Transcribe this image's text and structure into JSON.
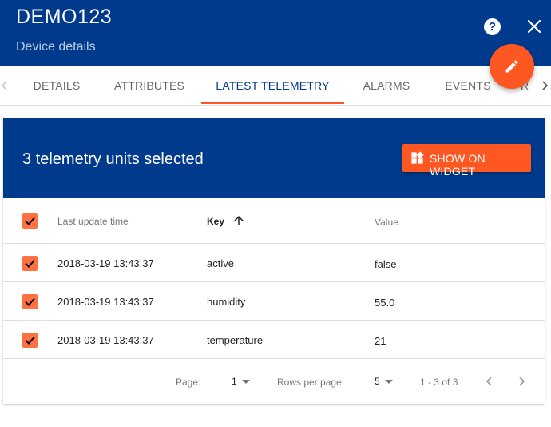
{
  "header": {
    "title": "DEMO123",
    "subtitle": "Device details",
    "help_label": "?"
  },
  "tabs": [
    {
      "label": "DETAILS"
    },
    {
      "label": "ATTRIBUTES"
    },
    {
      "label": "LATEST TELEMETRY",
      "active": true
    },
    {
      "label": "ALARMS"
    },
    {
      "label": "EVENTS"
    },
    {
      "label": "R"
    }
  ],
  "telemetry": {
    "selected_text": "3 telemetry units selected",
    "show_widget_label": "SHOW ON WIDGET",
    "columns": {
      "time": "Last update time",
      "key": "Key",
      "value": "Value"
    },
    "rows": [
      {
        "time": "2018-03-19 13:43:37",
        "key": "active",
        "value": "false",
        "checked": true
      },
      {
        "time": "2018-03-19 13:43:37",
        "key": "humidity",
        "value": "55.0",
        "checked": true
      },
      {
        "time": "2018-03-19 13:43:37",
        "key": "temperature",
        "value": "21",
        "checked": true
      }
    ]
  },
  "pagination": {
    "page_label": "Page:",
    "page_value": "1",
    "rows_label": "Rows per page:",
    "rows_value": "5",
    "range": "1 - 3 of 3"
  },
  "colors": {
    "primary": "#003a8c",
    "accent": "#ff5722",
    "checkbox": "#ff7043"
  },
  "icons": [
    "help-icon",
    "close-icon",
    "edit-icon",
    "chevron-left-icon",
    "chevron-right-icon",
    "widgets-icon",
    "arrow-up-icon",
    "check-icon",
    "dropdown-caret-icon"
  ]
}
